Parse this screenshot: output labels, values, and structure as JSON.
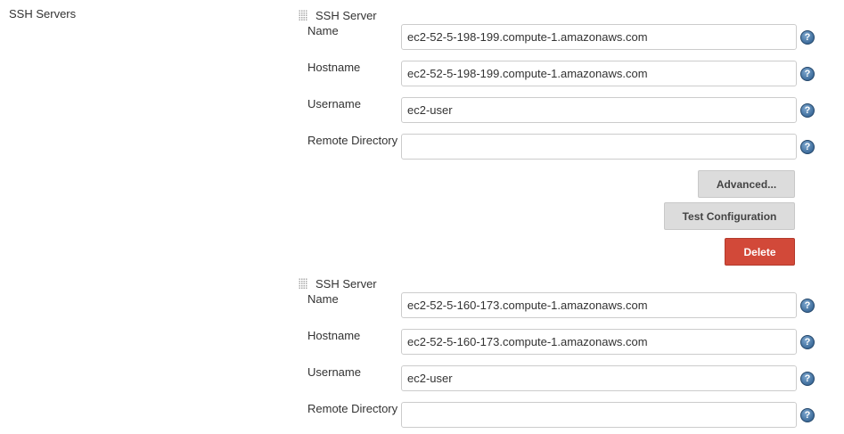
{
  "section": {
    "label": "SSH Servers"
  },
  "field_labels": {
    "name": "Name",
    "hostname": "Hostname",
    "username": "Username",
    "remote_directory": "Remote Directory"
  },
  "servers": [
    {
      "title": "SSH Server",
      "name": "ec2-52-5-198-199.compute-1.amazonaws.com",
      "hostname": "ec2-52-5-198-199.compute-1.amazonaws.com",
      "username": "ec2-user",
      "remote_directory": ""
    },
    {
      "title": "SSH Server",
      "name": "ec2-52-5-160-173.compute-1.amazonaws.com",
      "hostname": "ec2-52-5-160-173.compute-1.amazonaws.com",
      "username": "ec2-user",
      "remote_directory": ""
    }
  ],
  "buttons": {
    "advanced": "Advanced...",
    "test_configuration": "Test Configuration",
    "delete": "Delete"
  },
  "help_icon_glyph": "?",
  "colors": {
    "delete_button": "#d24939",
    "secondary_button": "#dcdcdc",
    "help_icon": "#3e6d9c"
  }
}
